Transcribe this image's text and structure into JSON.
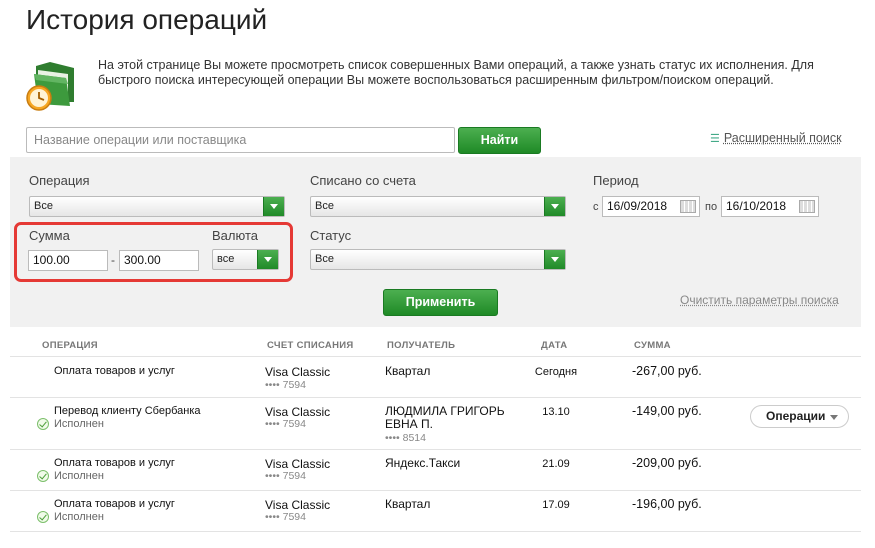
{
  "page_title": "История операций",
  "intro": "На этой странице Вы можете просмотреть список совершенных Вами операций, а также узнать статус их исполнения. Для быстрого поиска интересующей операции Вы можете воспользоваться расширенным фильтром/поиском операций.",
  "search": {
    "placeholder": "Название операции или поставщика",
    "value": "",
    "button": "Найти",
    "advanced_link": "Расширенный поиск"
  },
  "filters": {
    "operation": {
      "label": "Операция",
      "value": "Все"
    },
    "account": {
      "label": "Списано со счета",
      "value": "Все"
    },
    "period": {
      "label": "Период",
      "from_label": "с",
      "from": "16/09/2018",
      "to_label": "по",
      "to": "16/10/2018"
    },
    "sum": {
      "label": "Сумма",
      "from": "100.00",
      "separator": "-",
      "to": "300.00"
    },
    "currency": {
      "label": "Валюта",
      "value": "все"
    },
    "status": {
      "label": "Статус",
      "value": "Все"
    },
    "apply_button": "Применить",
    "clear_link": "Очистить параметры поиска"
  },
  "table": {
    "columns": [
      "ОПЕРАЦИЯ",
      "СЧЕТ СПИСАНИЯ",
      "ПОЛУЧАТЕЛЬ",
      "ДАТА",
      "СУММА"
    ],
    "rows": [
      {
        "operation": "Оплата товаров и услуг",
        "status": "",
        "account": "Visa Classic",
        "account_num": "•••• 7594",
        "recipient": "Квартал",
        "recipient_num": "",
        "date": "Сегодня",
        "amount": "-267,00 руб."
      },
      {
        "operation": "Перевод клиенту Сбербанка",
        "status": "Исполнен",
        "account": "Visa Classic",
        "account_num": "•••• 7594",
        "recipient": "ЛЮДМИЛА ГРИГОРЬ ЕВНА П.",
        "recipient_num": "•••• 8514",
        "date": "13.10",
        "amount": "-149,00 руб.",
        "action": "Операции"
      },
      {
        "operation": "Оплата товаров и услуг",
        "status": "Исполнен",
        "account": "Visa Classic",
        "account_num": "•••• 7594",
        "recipient": "Яндекс.Такси",
        "recipient_num": "",
        "date": "21.09",
        "amount": "-209,00 руб."
      },
      {
        "operation": "Оплата товаров и услуг",
        "status": "Исполнен",
        "account": "Visa Classic",
        "account_num": "•••• 7594",
        "recipient": "Квартал",
        "recipient_num": "",
        "date": "17.09",
        "amount": "-196,00 руб."
      }
    ]
  },
  "colors": {
    "accent_green": "#2e9c36",
    "highlight_red": "#e53935",
    "panel_bg": "#f1f1f1"
  }
}
